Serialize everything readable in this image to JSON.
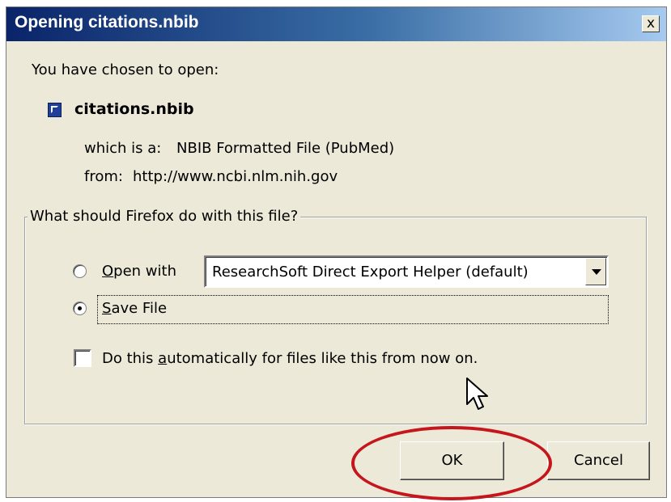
{
  "window": {
    "title": "Opening citations.nbib",
    "close_glyph": "x"
  },
  "intro": "You have chosen to open:",
  "file": {
    "icon": "nbib-file-icon",
    "name": "citations.nbib",
    "type_label": "which is a:",
    "type_value": "NBIB Formatted File (PubMed)",
    "from_label": "from:",
    "from_value": "http://www.ncbi.nlm.nih.gov"
  },
  "action_group": {
    "legend": "What should Firefox do with this file?",
    "open_with": {
      "label_mnemonic": "O",
      "label_rest": "pen with",
      "selected": false,
      "app": "ResearchSoft Direct Export Helper (default)"
    },
    "save_file": {
      "label_mnemonic": "S",
      "label_rest": "ave File",
      "selected": true
    },
    "auto": {
      "label_pre": "Do this ",
      "label_mnemonic": "a",
      "label_post": "utomatically for files like this from now on.",
      "checked": false
    }
  },
  "buttons": {
    "ok": "OK",
    "cancel": "Cancel"
  },
  "annotation": {
    "highlight_color": "#c4161c"
  },
  "colors": {
    "title_bar": "#0a246a",
    "dialog_bg": "#ece9d8"
  }
}
